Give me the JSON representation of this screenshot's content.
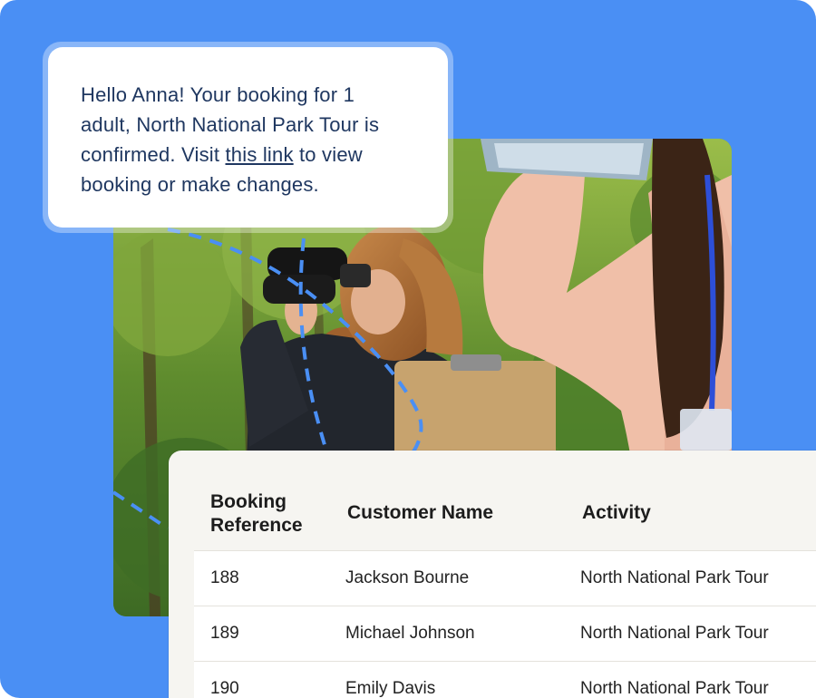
{
  "message": {
    "line1": "Hello Anna! Your booking for 1",
    "line2": "adult, North National Park Tour is",
    "line3_prefix": "confirmed. Visit ",
    "link_text": "this link",
    "line3_suffix": " to view",
    "line4": "booking or make changes."
  },
  "photo": {
    "description_icon": "park-tour-photo"
  },
  "table": {
    "headers": {
      "reference_line1": "Booking",
      "reference_line2": "Reference",
      "customer": "Customer Name",
      "activity": "Activity"
    },
    "rows": [
      {
        "reference": "188",
        "customer": "Jackson Bourne",
        "activity": "North National Park Tour"
      },
      {
        "reference": "189",
        "customer": "Michael Johnson",
        "activity": "North National Park Tour"
      },
      {
        "reference": "190",
        "customer": "Emily Davis",
        "activity": "North National Park Tour"
      }
    ]
  },
  "colors": {
    "background": "#4a8ff4",
    "bubble_text": "#1f3760",
    "table_bg": "#f6f5f1"
  }
}
